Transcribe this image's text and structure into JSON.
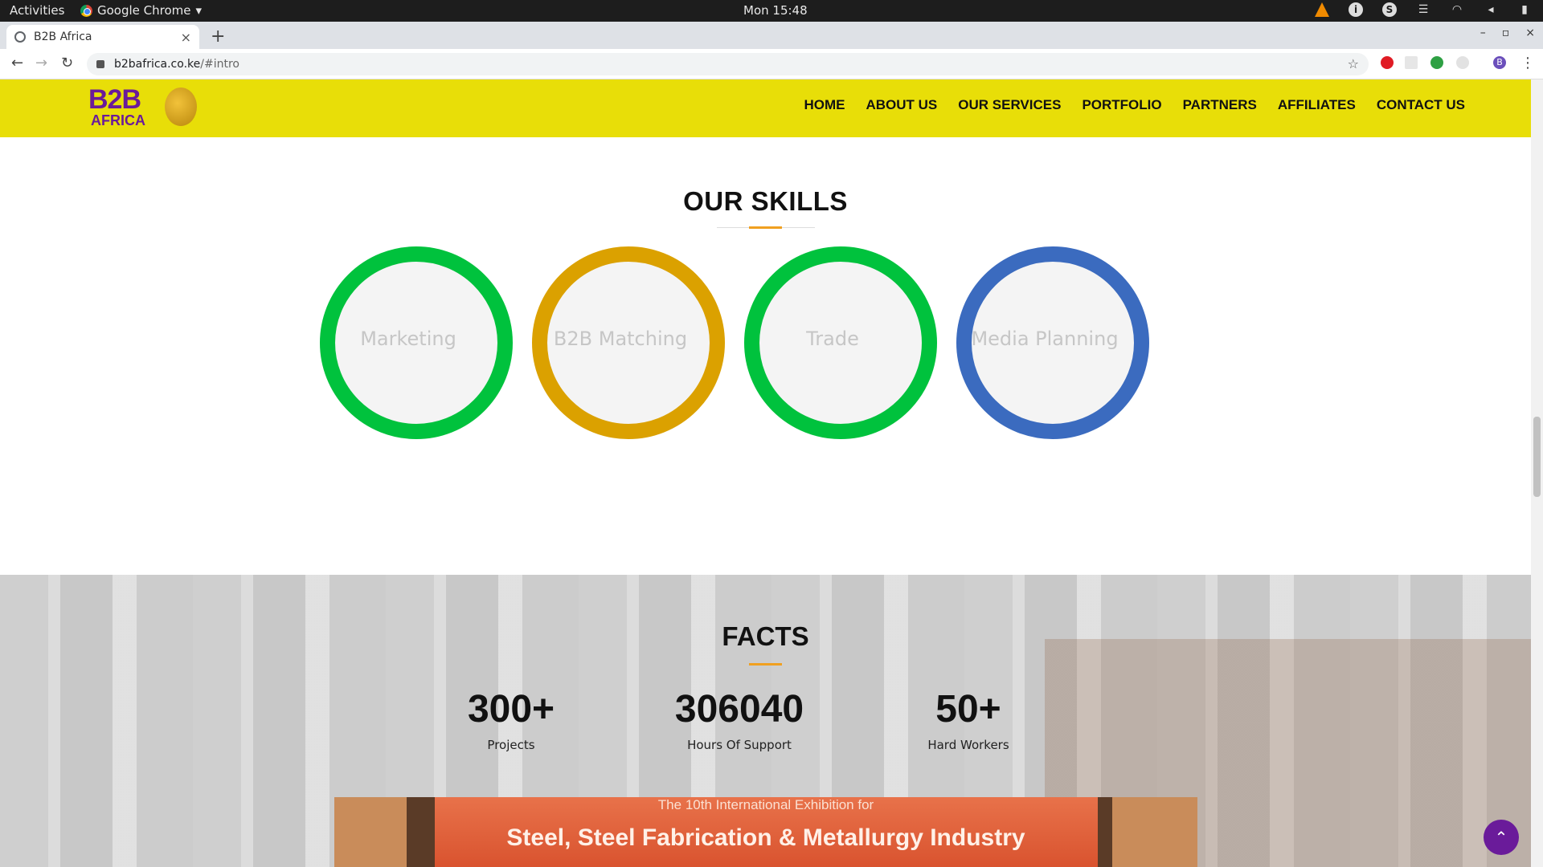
{
  "os": {
    "activities": "Activities",
    "app_name": "Google Chrome",
    "app_menu_arrow": "▾",
    "clock": "Mon 15:48",
    "tray_icons": [
      "vlc-icon",
      "update-icon",
      "skype-icon",
      "menu-icon",
      "wifi-icon",
      "volume-icon",
      "battery-icon",
      "power-menu-icon"
    ]
  },
  "browser": {
    "tab_title": "B2B Africa",
    "tab_close": "×",
    "new_tab": "+",
    "url_host": "b2bafrica.co.ke",
    "url_path": "/#intro",
    "back": "←",
    "forward": "→",
    "reload": "↻",
    "star": "☆",
    "window_controls": [
      "–",
      "▫",
      "×"
    ],
    "profile_initial": "B",
    "menu": "⋮"
  },
  "site": {
    "logo_line1": "B2B",
    "logo_line2": "AFRICA",
    "nav": [
      "HOME",
      "ABOUT US",
      "OUR SERVICES",
      "PORTFOLIO",
      "PARTNERS",
      "AFFILIATES",
      "CONTACT US"
    ],
    "skills_title": "OUR SKILLS",
    "skills": [
      {
        "label": "Marketing",
        "color": "#00c23d"
      },
      {
        "label": "B2B Matching",
        "color": "#dba100"
      },
      {
        "label": "Trade",
        "color": "#00c23d"
      },
      {
        "label": "Media Planning",
        "color": "#3b6bbf"
      }
    ],
    "facts_title": "FACTS",
    "facts": [
      {
        "value": "300+",
        "label": "Projects"
      },
      {
        "value": "306040",
        "label": "Hours Of Support"
      },
      {
        "value": "50+",
        "label": "Hard Workers"
      }
    ],
    "banner_line1": "The 10th International Exhibition for",
    "banner_line2": "Steel, Steel Fabrication & Metallurgy Industry",
    "back_to_top": "⌃"
  },
  "colors": {
    "header_bg": "#e8de08",
    "brand_purple": "#6a1b9a",
    "accent_orange": "#f0a020"
  }
}
